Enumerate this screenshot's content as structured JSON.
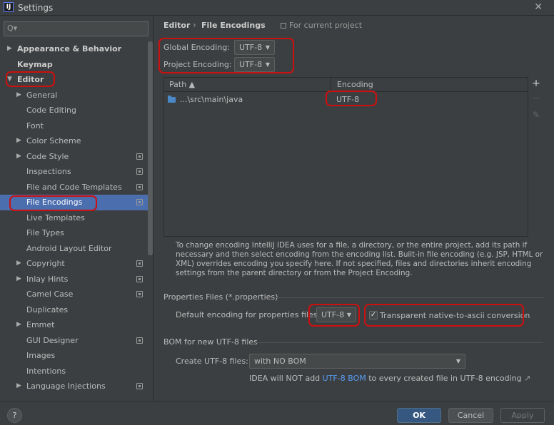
{
  "window": {
    "title": "Settings",
    "app_icon": "intellij-logo-icon",
    "close_icon": "close-icon"
  },
  "search": {
    "placeholder": "Q▾",
    "icon": "search-icon"
  },
  "sidebar": {
    "items": [
      {
        "label": "Appearance & Behavior",
        "level": 0,
        "expandable": true
      },
      {
        "label": "Keymap",
        "level": 0
      },
      {
        "label": "Editor",
        "level": 0,
        "expanded": true
      },
      {
        "label": "General",
        "level": 1,
        "expandable": true
      },
      {
        "label": "Code Editing",
        "level": 1
      },
      {
        "label": "Font",
        "level": 1
      },
      {
        "label": "Color Scheme",
        "level": 1,
        "expandable": true
      },
      {
        "label": "Code Style",
        "level": 1,
        "expandable": true,
        "project_icon": true
      },
      {
        "label": "Inspections",
        "level": 1,
        "project_icon": true
      },
      {
        "label": "File and Code Templates",
        "level": 1,
        "project_icon": true
      },
      {
        "label": "File Encodings",
        "level": 1,
        "project_icon": true,
        "selected": true
      },
      {
        "label": "Live Templates",
        "level": 1
      },
      {
        "label": "File Types",
        "level": 1
      },
      {
        "label": "Android Layout Editor",
        "level": 1
      },
      {
        "label": "Copyright",
        "level": 1,
        "expandable": true,
        "project_icon": true
      },
      {
        "label": "Inlay Hints",
        "level": 1,
        "expandable": true,
        "project_icon": true
      },
      {
        "label": "Camel Case",
        "level": 1,
        "project_icon": true
      },
      {
        "label": "Duplicates",
        "level": 1
      },
      {
        "label": "Emmet",
        "level": 1,
        "expandable": true
      },
      {
        "label": "GUI Designer",
        "level": 1,
        "project_icon": true
      },
      {
        "label": "Images",
        "level": 1
      },
      {
        "label": "Intentions",
        "level": 1
      },
      {
        "label": "Language Injections",
        "level": 1,
        "expandable": true,
        "project_icon": true
      }
    ]
  },
  "breadcrumb": {
    "section": "Editor",
    "separator": "›",
    "page": "File Encodings",
    "scope": "For current project"
  },
  "encodings": {
    "global_label": "Global Encoding:",
    "global_value": "UTF-8",
    "project_label": "Project Encoding:",
    "project_value": "UTF-8"
  },
  "table": {
    "columns": [
      "Path ▲",
      "Encoding"
    ],
    "rows": [
      {
        "path": "...\\src\\main\\java",
        "encoding": "UTF-8"
      }
    ],
    "tools": {
      "add": "+",
      "remove": "—",
      "edit": "✎"
    }
  },
  "note": "To change encoding IntelliJ IDEA uses for a file, a directory, or the entire project, add its path if necessary and then select encoding from the encoding list. Built-in file encoding (e.g. JSP, HTML or XML) overrides encoding you specify here. If not specified, files and directories inherit encoding settings from the parent directory or from the Project Encoding.",
  "properties": {
    "section_title": "Properties Files (*.properties)",
    "default_label": "Default encoding for properties files",
    "default_value": "UTF-8",
    "transparent_label": "Transparent native-to-ascii conversion",
    "transparent_checked": true
  },
  "bom": {
    "section_title": "BOM for new UTF-8 files",
    "create_label": "Create UTF-8 files:",
    "create_value": "with NO BOM",
    "info_prefix": "IDEA will NOT add",
    "info_link": "UTF-8 BOM",
    "info_suffix": "to every created file in UTF-8 encoding",
    "info_arrow": "↗"
  },
  "footer": {
    "help": "?",
    "ok": "OK",
    "cancel": "Cancel",
    "apply": "Apply"
  },
  "colors": {
    "accent": "#4b6eaf",
    "highlight_ring": "#cc1010",
    "link": "#589df6",
    "background": "#3c3f41"
  }
}
